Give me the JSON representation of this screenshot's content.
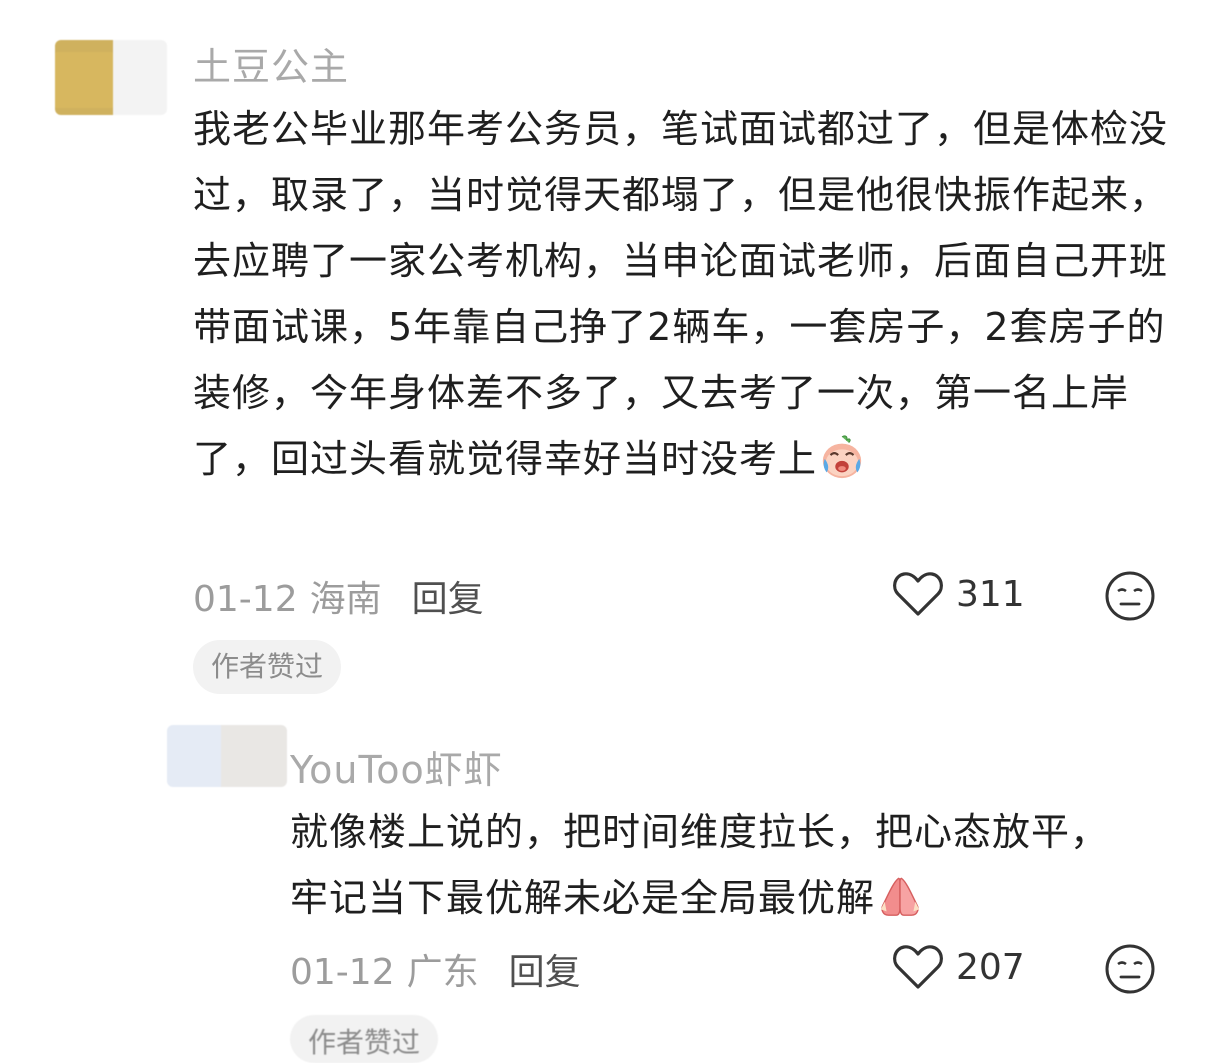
{
  "comments": [
    {
      "username": "土豆公主",
      "text": "我老公毕业那年考公务员，笔试面试都过了，但是体检没过，取录了，当时觉得天都塌了，但是他很快振作起来，去应聘了一家公考机构，当申论面试老师，后面自己开班带面试课，5年靠自己挣了2辆车，一套房子，2套房子的装修，今年身体差不多了，又去考了一次，第一名上岸了，回过头看就觉得幸好当时没考上",
      "emoji": "crying-laughing-emoji",
      "date": "01-12",
      "location": "海南",
      "reply_label": "回复",
      "like_count": "311",
      "author_liked": "作者赞过"
    },
    {
      "username": "YouToo虾虾",
      "text": "就像楼上说的，把时间维度拉长，把心态放平，牢记当下最优解未必是全局最优解",
      "emoji": "praying-hands-emoji",
      "date": "01-12",
      "location": "广东",
      "reply_label": "回复",
      "like_count": "207",
      "author_liked": "作者赞过"
    }
  ],
  "icons": {
    "like": "heart-outline-icon",
    "dislike": "meh-face-icon"
  },
  "colors": {
    "username": "#a9a9a9",
    "meta": "#9c9c9c",
    "text": "#1f1f1f",
    "badge_bg": "#f2f2f2"
  }
}
